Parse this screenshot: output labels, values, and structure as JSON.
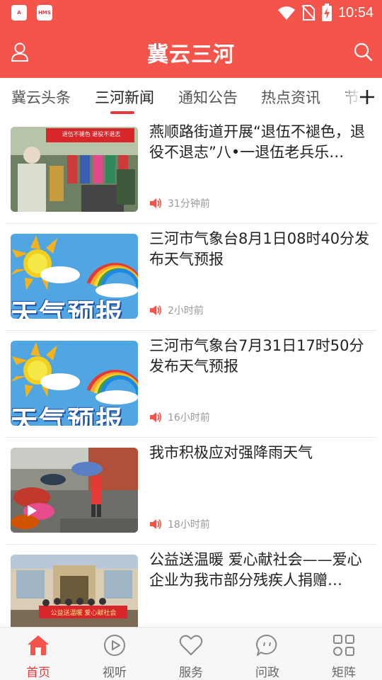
{
  "status_bar": {
    "time": "10:54",
    "app_icons": [
      "A",
      "HMS"
    ]
  },
  "header": {
    "title": "冀云三河"
  },
  "tabs": [
    {
      "label": "冀云头条",
      "active": false
    },
    {
      "label": "三河新闻",
      "active": true
    },
    {
      "label": "通知公告",
      "active": false
    },
    {
      "label": "热点资讯",
      "active": false
    },
    {
      "label": "节",
      "active": false
    }
  ],
  "news": [
    {
      "title": "燕顺路街道开展“退伍不褪色，退役不退志”八•一退伍老兵乐…",
      "time": "31分钟前",
      "thumb": "band-photo"
    },
    {
      "title": "三河市气象台8月1日08时40分发布天气预报",
      "time": "2小时前",
      "thumb": "weather-forecast"
    },
    {
      "title": "三河市气象台7月31日17时50分发布天气预报",
      "time": "16小时前",
      "thumb": "weather-forecast"
    },
    {
      "title": "我市积极应对强降雨天气",
      "time": "18小时前",
      "thumb": "rain-video"
    },
    {
      "title": "公益送温暖 爱心献社会——爱心企业为我市部分残疾人捐赠…",
      "time": "",
      "thumb": "donation-photo"
    }
  ],
  "thumb_text": {
    "weather_1": "天气预报",
    "weather_2": "天气预报",
    "banner_line1": "退伍不褪色 退役不退志",
    "donation_banner": "公益送温暖 爱心献社会"
  },
  "bottom_nav": [
    {
      "label": "首页",
      "active": true
    },
    {
      "label": "视听",
      "active": false
    },
    {
      "label": "服务",
      "active": false
    },
    {
      "label": "问政",
      "active": false
    },
    {
      "label": "矩阵",
      "active": false
    }
  ],
  "colors": {
    "brand_red": "#f4544a",
    "active_red": "#e8393f",
    "text_dark": "#222222",
    "text_gray": "#999999"
  }
}
